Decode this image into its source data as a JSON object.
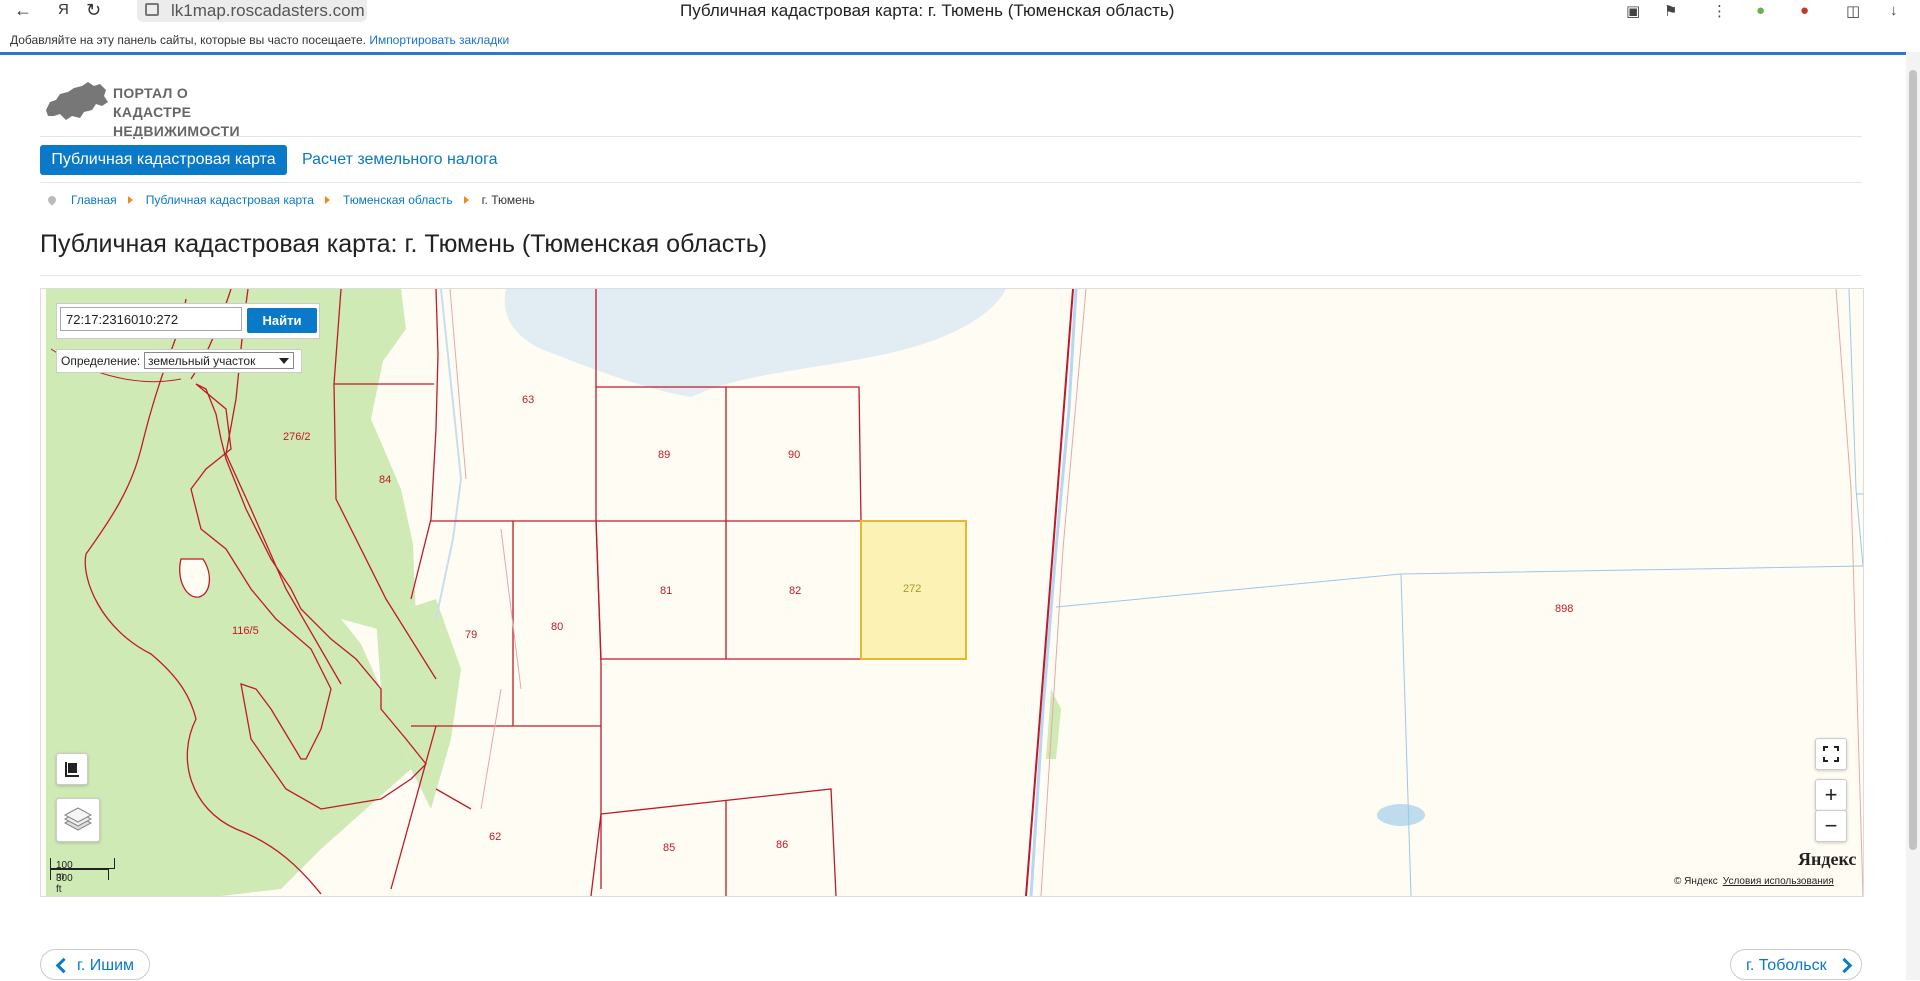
{
  "browser": {
    "url": "lk1map.roscadasters.com",
    "tab_title": "Публичная кадастровая карта: г. Тюмень (Тюменская область)",
    "bookmarks_hint": "Добавляйте на эту панель сайты, которые вы часто посещаете.",
    "bookmarks_import": "Импортировать закладки"
  },
  "site": {
    "logo_line1": "ПОРТАЛ О КАДАСТРЕ",
    "logo_line2": "НЕДВИЖИМОСТИ В РФ"
  },
  "nav": {
    "active_tab": "Публичная кадастровая карта",
    "tab2": "Расчет земельного налога"
  },
  "breadcrumb": [
    "Главная",
    "Публичная кадастровая карта",
    "Тюменская область",
    "г. Тюмень"
  ],
  "page_title": "Публичная кадастровая карта: г. Тюмень (Тюменская область)",
  "map": {
    "search_value": "72:17:2316010:272",
    "search_button": "Найти",
    "definition_label": "Определение:",
    "definition_selected": "земельный участок",
    "parcel_labels": [
      "63",
      "89",
      "90",
      "276/2",
      "84",
      "81",
      "82",
      "272",
      "116/5",
      "79",
      "80",
      "898",
      "62",
      "85",
      "86"
    ],
    "scale_metric": "100 m",
    "scale_imperial": "300 ft",
    "zoom_in": "+",
    "zoom_out": "−",
    "yandex_logo": "Яндекс",
    "copyright": "© Яндекс",
    "terms": "Условия использования",
    "highlight_color": "#fbf2b4",
    "parcel_color": "#c0192b"
  },
  "pager": {
    "prev": "г. Ишим",
    "next": "г. Тобольск"
  }
}
